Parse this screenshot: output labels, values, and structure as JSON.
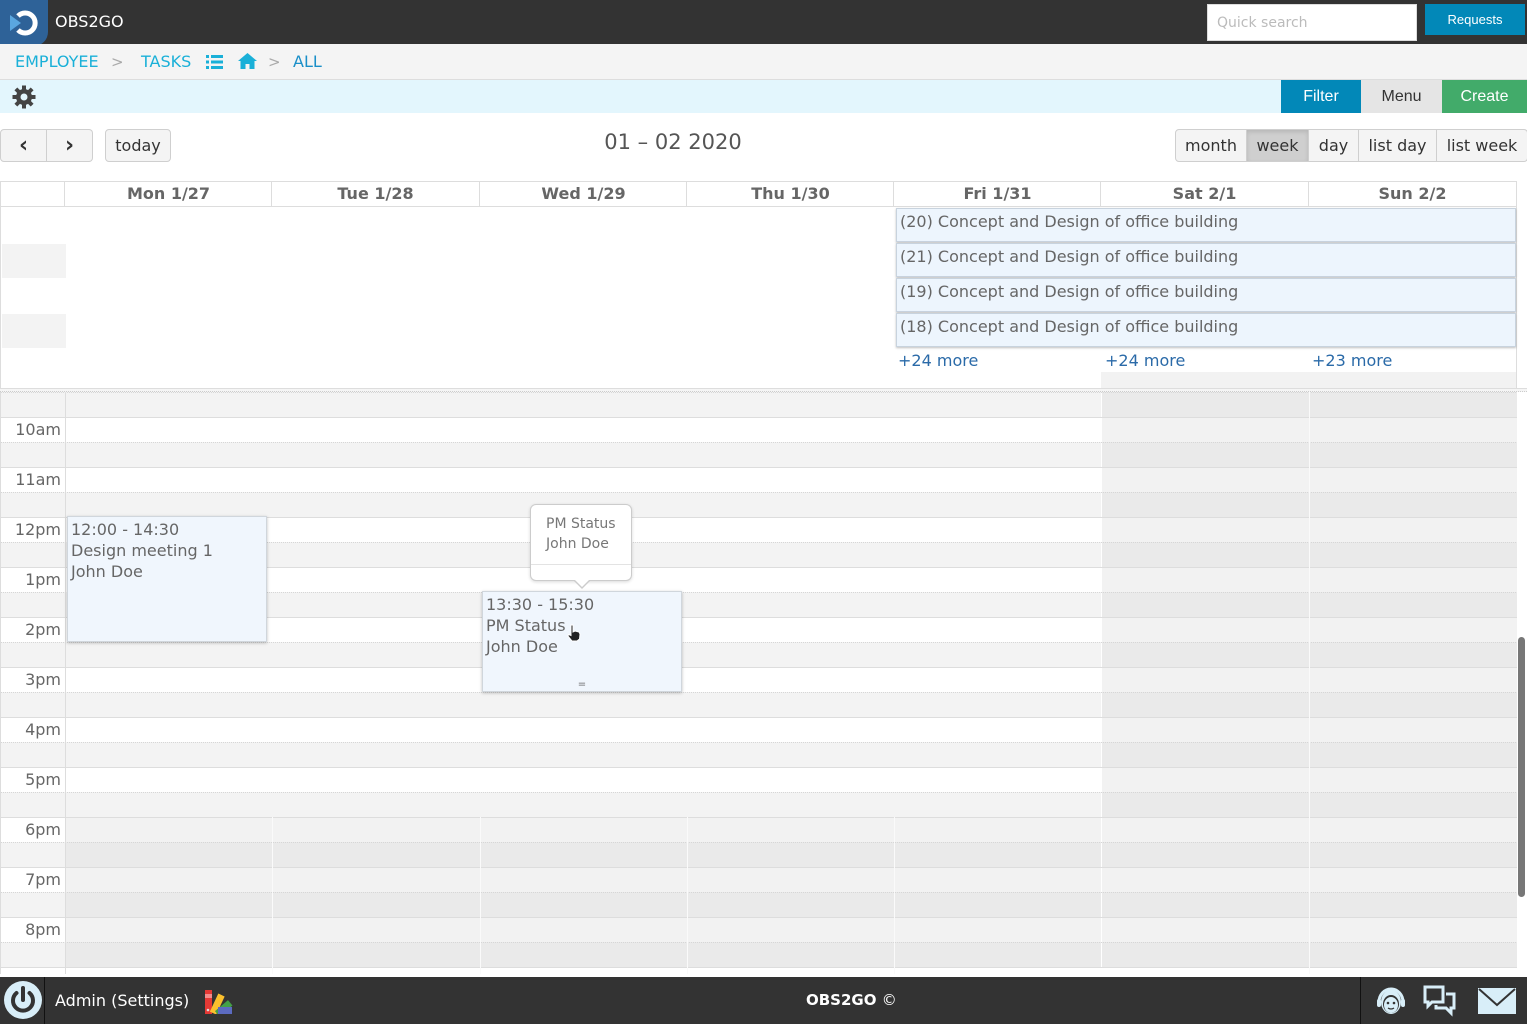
{
  "app": {
    "name": "OBS2GO"
  },
  "header": {
    "search_placeholder": "Quick search",
    "requests_label": "Requests"
  },
  "breadcrumb": {
    "items": [
      "EMPLOYEE",
      "TASKS",
      "ALL"
    ],
    "separator": ">"
  },
  "toolbar": {
    "filter_label": "Filter",
    "menu_label": "Menu",
    "create_label": "Create"
  },
  "calendar": {
    "title": "01 – 02 2020",
    "prev_label": "‹",
    "next_label": "›",
    "today_label": "today",
    "views": [
      "month",
      "week",
      "day",
      "list day",
      "list week"
    ],
    "active_view": "week",
    "days": [
      "Mon 1/27",
      "Tue 1/28",
      "Wed 1/29",
      "Thu 1/30",
      "Fri 1/31",
      "Sat 2/1",
      "Sun 2/2"
    ],
    "allday_events": [
      "(20) Concept and Design of office building",
      "(21) Concept and Design of office building",
      "(19) Concept and Design of office building",
      "(18) Concept and Design of office building"
    ],
    "more_links": [
      {
        "day": "Fri 1/31",
        "label": "+24 more"
      },
      {
        "day": "Sat 2/1",
        "label": "+24 more"
      },
      {
        "day": "Sun 2/2",
        "label": "+23 more"
      }
    ],
    "time_labels": [
      "10am",
      "11am",
      "12pm",
      "1pm",
      "2pm",
      "3pm",
      "4pm",
      "5pm",
      "6pm",
      "7pm",
      "8pm"
    ],
    "events": [
      {
        "day": "Mon 1/27",
        "time": "12:00 - 14:30",
        "title": "Design meeting 1",
        "person": "John Doe"
      },
      {
        "day": "Wed 1/29",
        "time": "13:30 - 15:30",
        "title": "PM Status",
        "person": "John Doe"
      }
    ],
    "tooltip": {
      "title": "PM Status",
      "person": "John Doe"
    }
  },
  "footer": {
    "user_label": "Admin (Settings)",
    "copyright": "OBS2GO",
    "copyright_symbol": "©"
  },
  "icons": {
    "logo": "obs2go-logo-icon",
    "breadcrumb_list": "list-icon",
    "breadcrumb_home": "home-icon",
    "settings": "gear-icon",
    "power": "power-icon",
    "theme": "color-palette-icon",
    "support": "support-agent-icon",
    "chat": "chat-icon",
    "mail": "mail-icon"
  }
}
